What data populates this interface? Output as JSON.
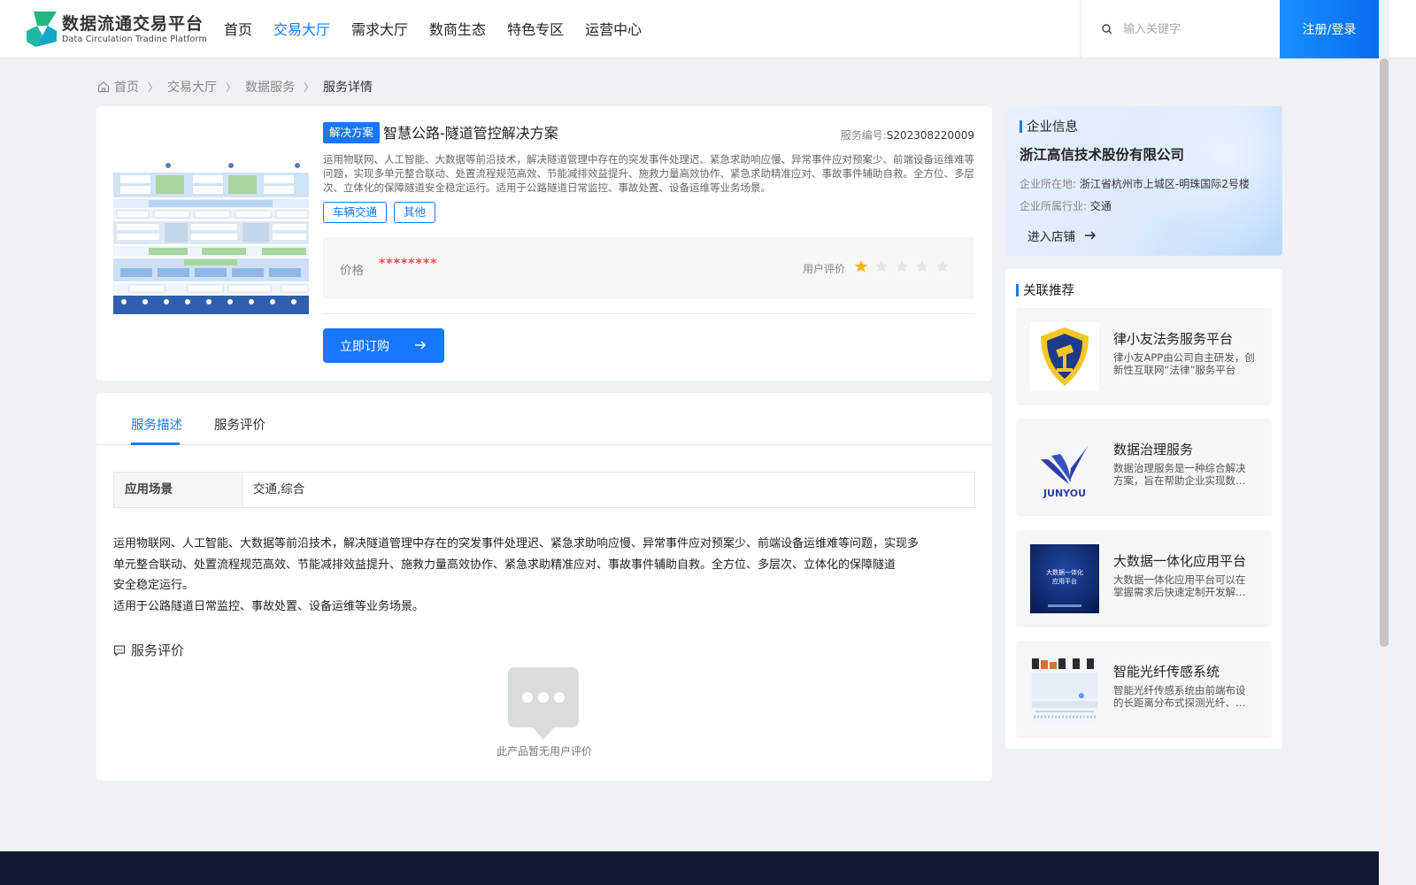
{
  "header": {
    "logo_title": "数据流通交易平台",
    "logo_sub": "Data Circulation Tradine Platform",
    "nav": [
      "首页",
      "交易大厅",
      "需求大厅",
      "数商生态",
      "特色专区",
      "运营中心"
    ],
    "active_nav": 1,
    "search_placeholder": "输入关键字",
    "login_label": "注册/登录"
  },
  "breadcrumb": [
    "首页",
    "交易大厅",
    "数据服务",
    "服务详情"
  ],
  "product": {
    "type_tag": "解决方案",
    "title": "智慧公路-隧道管控解决方案",
    "service_no_label": "服务编号:",
    "service_no": "S202308220009",
    "description": "运用物联网、人工智能、大数据等前沿技术，解决隧道管理中存在的突发事件处理迟、紧急求助响应慢、异常事件应对预案少、前端设备运维难等问题，实现多单元整合联动、处置流程规范高效、节能减排效益提升、施救力量高效协作、紧急求助精准应对、事故事件辅助自救。全方位、多层次、立体化的保障隧道安全稳定运行。适用于公路隧道日常监控、事故处置、设备运维等业务场景。",
    "tags": [
      "车辆交通",
      "其他"
    ],
    "price_label": "价格",
    "price_value": "********",
    "rating_label": "用户评价",
    "rating": 1,
    "rating_max": 5,
    "order_label": "立即订购"
  },
  "detail": {
    "tabs": [
      "服务描述",
      "服务评价"
    ],
    "scene_label": "应用场景",
    "scene_value": "交通,综合",
    "text_lines": [
      "运用物联网、人工智能、大数据等前沿技术，解决隧道管理中存在的突发事件处理迟、紧急求助响应慢、异常事件应对预案少、前端设备运维难等问题，实现多",
      "单元整合联动、处置流程规范高效、节能减排效益提升、施救力量高效协作、紧急求助精准应对、事故事件辅助自救。全方位、多层次、立体化的保障隧道",
      "安全稳定运行。",
      "适用于公路隧道日常监控、事故处置、设备运维等业务场景。"
    ],
    "review_title": "服务评价",
    "empty_text": "此产品暂无用户评价"
  },
  "company": {
    "section_title": "企业信息",
    "name": "浙江高信技术股份有限公司",
    "location_label": "企业所在地:",
    "location": "浙江省杭州市上城区-明珠国际2号楼",
    "industry_label": "企业所属行业:",
    "industry": "交通",
    "enter_label": "进入店铺"
  },
  "recommend": {
    "section_title": "关联推荐",
    "items": [
      {
        "name": "律小友法务服务平台",
        "desc": "律小友APP由公司自主研发，创新性互联网“法律”服务平台"
      },
      {
        "name": "数据治理服务",
        "desc": "数据治理服务是一种综合解决方案，旨在帮助企业实现数据资产"
      },
      {
        "name": "大数据一体化应用平台",
        "desc": "大数据一体化应用平台可以在掌握需求后快速定制开发解决方案"
      },
      {
        "name": "智能光纤传感系统",
        "desc": "智能光纤传感系统由前端布设的长距离分布式探测光纤、解调设备"
      }
    ]
  },
  "image_text": {
    "thumb3_line1": "大数据一体化",
    "thumb3_line2": "应用平台",
    "junyou": "JUNYOU"
  },
  "colors": {
    "accent": "#1677ff",
    "price": "#f04848",
    "star_on": "#f7b500",
    "star_off": "#e3e5e8",
    "footer": "#101834"
  }
}
